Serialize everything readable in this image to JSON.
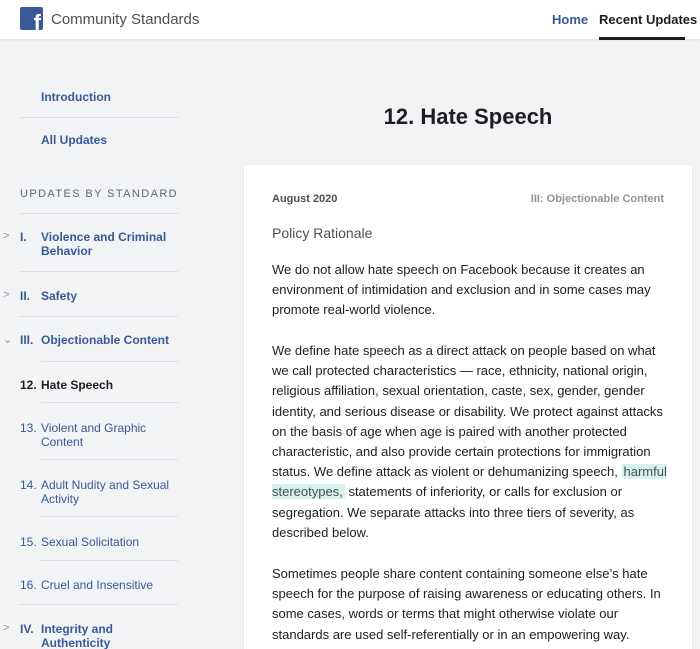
{
  "header": {
    "logo_glyph": "f",
    "site_title": "Community Standards",
    "nav": {
      "home": "Home",
      "recent_updates": "Recent Updates"
    }
  },
  "sidebar": {
    "introduction": "Introduction",
    "all_updates": "All Updates",
    "heading": "UPDATES BY STANDARD",
    "sections": [
      {
        "numeral": "I.",
        "label": "Violence and Criminal Behavior"
      },
      {
        "numeral": "II.",
        "label": "Safety"
      },
      {
        "numeral": "III.",
        "label": "Objectionable Content"
      }
    ],
    "subitems": [
      {
        "num": "12.",
        "label": "Hate Speech"
      },
      {
        "num": "13.",
        "label": "Violent and Graphic Content"
      },
      {
        "num": "14.",
        "label": "Adult Nudity and Sexual Activity"
      },
      {
        "num": "15.",
        "label": "Sexual Solicitation"
      },
      {
        "num": "16.",
        "label": "Cruel and Insensitive"
      }
    ],
    "section4": {
      "numeral": "IV.",
      "label": "Integrity and Authenticity"
    }
  },
  "main": {
    "title": "12. Hate Speech",
    "date": "August 2020",
    "category": "III: Objectionable Content",
    "section_heading": "Policy Rationale",
    "para1": "We do not allow hate speech on Facebook because it creates an environment of intimidation and exclusion and in some cases may promote real-world violence.",
    "para2_a": "We define hate speech as a direct attack on people based on what we call protected characteristics — race, ethnicity, national origin, religious affiliation, sexual orientation, caste, sex, gender, gender identity, and serious disease or disability. We protect against attacks on the basis of age when age is paired with another protected characteristic, and also provide certain protections for immigration status. We define attack as violent or dehumanizing speech, ",
    "para2_highlight": "harmful stereotypes,",
    "para2_b": " statements of inferiority, or calls for exclusion or segregation. We separate attacks into three tiers of severity, as described below.",
    "para3": "Sometimes people share content containing someone else’s hate speech for the purpose of raising awareness or educating others. In some cases, words or terms that might otherwise violate our standards are used self-referentially or in an empowering way."
  },
  "colors": {
    "brand": "#3b5998",
    "link": "#385898",
    "highlight": "#d5f2ec"
  }
}
